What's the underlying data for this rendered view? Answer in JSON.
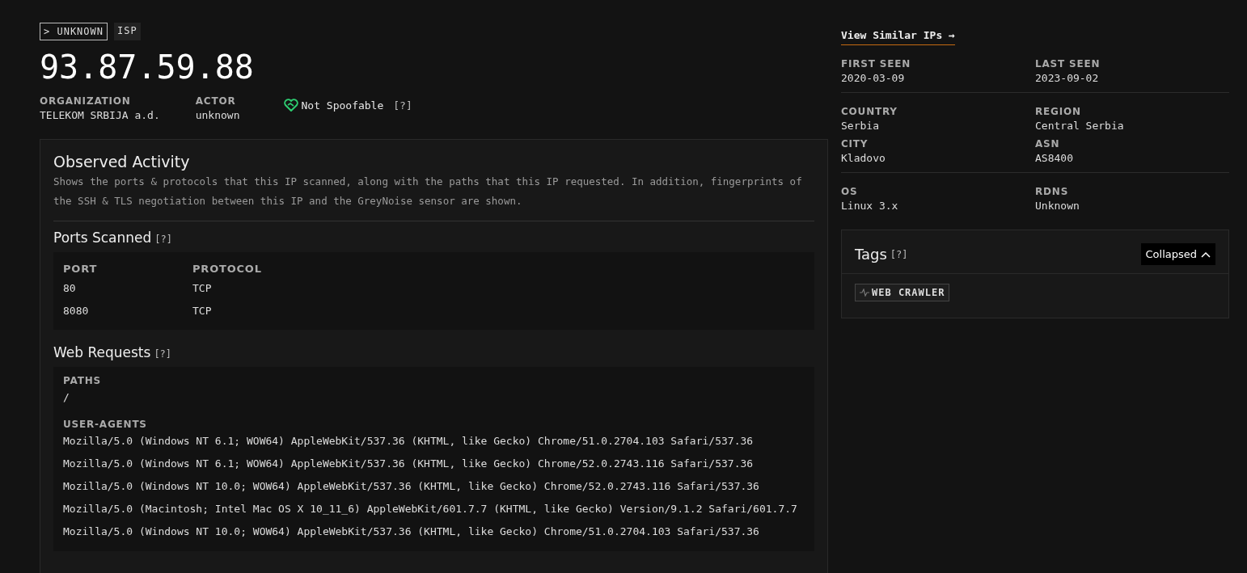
{
  "badges": [
    {
      "kind": "classification",
      "prefix": ">",
      "label": "UNKNOWN"
    },
    {
      "kind": "type",
      "label": "ISP"
    }
  ],
  "ip": "93.87.59.88",
  "summary": [
    {
      "label": "ORGANIZATION",
      "value": "TELEKOM SRBIJA a.d."
    },
    {
      "label": "ACTOR",
      "value": "unknown"
    }
  ],
  "spoofable": {
    "spoofable": false,
    "label": "Not Spoofable",
    "help": "[?]"
  },
  "activity": {
    "title": "Observed Activity",
    "description": "Shows the ports & protocols that this IP scanned, along with the paths that this IP requested. In addition, fingerprints of the SSH & TLS negotiation between this IP and the GreyNoise sensor are shown.",
    "ports": {
      "title": "Ports Scanned",
      "help": "[?]",
      "columns": [
        "PORT",
        "PROTOCOL"
      ],
      "rows": [
        [
          "80",
          "TCP"
        ],
        [
          "8080",
          "TCP"
        ]
      ]
    },
    "web": {
      "title": "Web Requests",
      "help": "[?]",
      "paths_label": "PATHS",
      "paths": [
        "/"
      ],
      "agents_label": "USER-AGENTS",
      "agents": [
        "Mozilla/5.0 (Windows NT 6.1; WOW64) AppleWebKit/537.36 (KHTML, like Gecko) Chrome/51.0.2704.103 Safari/537.36",
        "Mozilla/5.0 (Windows NT 6.1; WOW64) AppleWebKit/537.36 (KHTML, like Gecko) Chrome/52.0.2743.116 Safari/537.36",
        "Mozilla/5.0 (Windows NT 10.0; WOW64) AppleWebKit/537.36 (KHTML, like Gecko) Chrome/52.0.2743.116 Safari/537.36",
        "Mozilla/5.0 (Macintosh; Intel Mac OS X 10_11_6) AppleWebKit/601.7.7 (KHTML, like Gecko) Version/9.1.2 Safari/601.7.7",
        "Mozilla/5.0 (Windows NT 10.0; WOW64) AppleWebKit/537.36 (KHTML, like Gecko) Chrome/51.0.2704.103 Safari/537.36"
      ]
    }
  },
  "similar_link": "View Similar IPs →",
  "details": [
    [
      {
        "label": "FIRST SEEN",
        "value": "2020-03-09"
      },
      {
        "label": "LAST SEEN",
        "value": "2023-09-02"
      }
    ],
    [
      {
        "label": "COUNTRY",
        "value": "Serbia"
      },
      {
        "label": "REGION",
        "value": "Central Serbia"
      },
      {
        "label": "CITY",
        "value": "Kladovo"
      },
      {
        "label": "ASN",
        "value": "AS8400"
      }
    ],
    [
      {
        "label": "OS",
        "value": "Linux 3.x"
      },
      {
        "label": "RDNS",
        "value": "Unknown"
      }
    ]
  ],
  "tags": {
    "title": "Tags",
    "help": "[?]",
    "toggle": "Collapsed",
    "expanded": false,
    "items": [
      "WEB CRAWLER"
    ]
  }
}
